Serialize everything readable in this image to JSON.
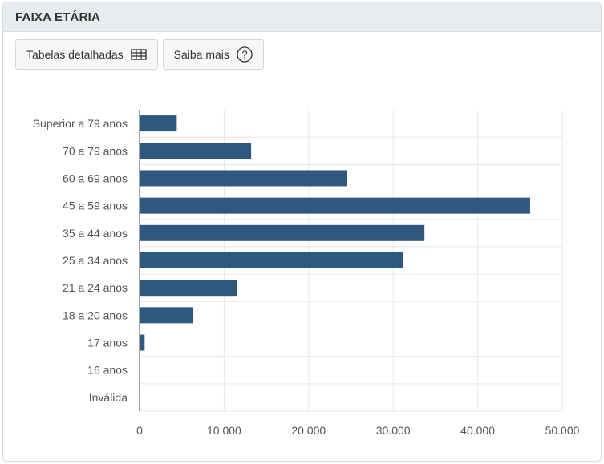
{
  "panel": {
    "title": "FAIXA ETÁRIA"
  },
  "toolbar": {
    "tables_label": "Tabelas detalhadas",
    "tables_icon": "table-icon",
    "learn_label": "Saiba mais",
    "learn_icon": "help-circle-icon"
  },
  "colors": {
    "bar": "#2e5880",
    "grid": "#e6e8eb",
    "axis": "#666666"
  },
  "chart_data": {
    "type": "bar",
    "orientation": "horizontal",
    "categories": [
      "Superior a 79 anos",
      "70 a 79 anos",
      "60 a 69 anos",
      "45 a 59 anos",
      "35 a 44 anos",
      "25 a 34 anos",
      "21 a 24 anos",
      "18 a 20 anos",
      "17 anos",
      "16 anos",
      "Inválida"
    ],
    "values": [
      4400,
      13200,
      24500,
      46200,
      33700,
      31200,
      11500,
      6300,
      600,
      0,
      0
    ],
    "xlim": [
      0,
      50000
    ],
    "xticks": [
      0,
      10000,
      20000,
      30000,
      40000,
      50000
    ],
    "xtick_labels": [
      "0",
      "10.000",
      "20.000",
      "30.000",
      "40.000",
      "50.000"
    ],
    "grid": true
  }
}
